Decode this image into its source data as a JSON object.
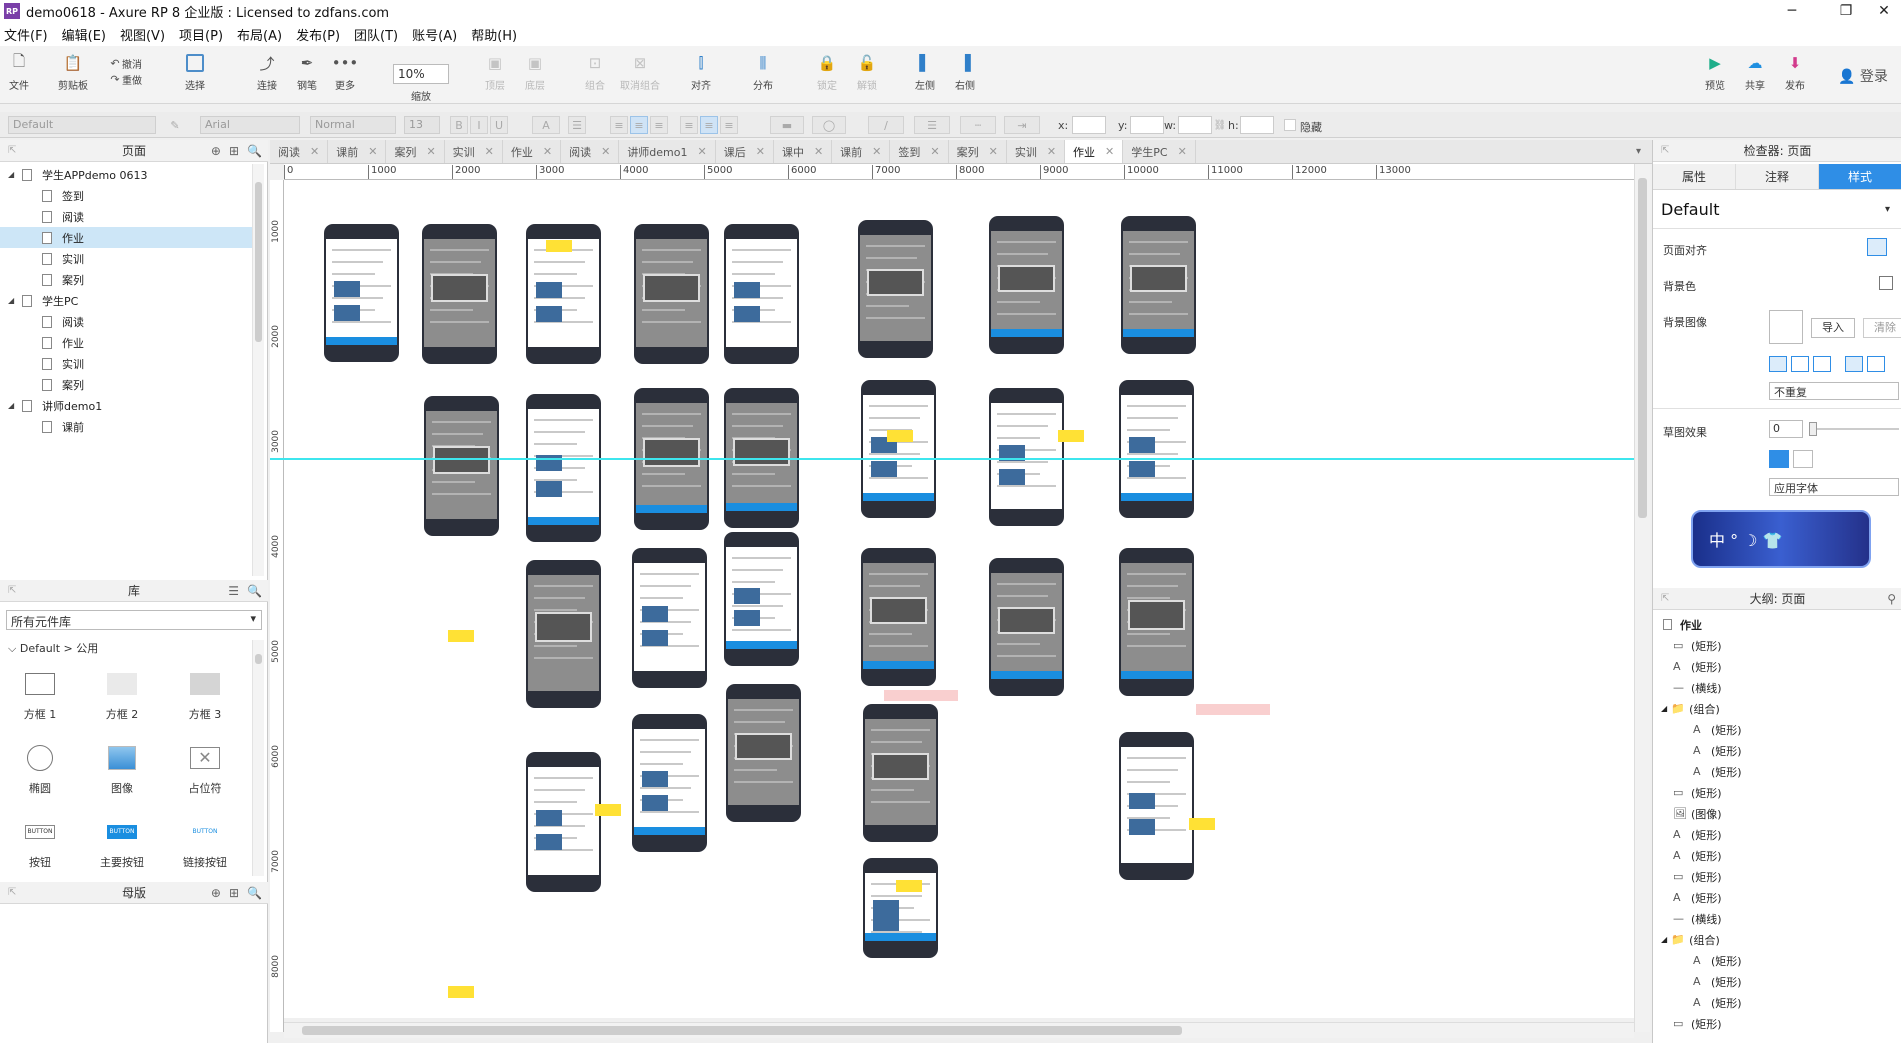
{
  "window": {
    "title": "demo0618 - Axure RP 8 企业版 : Licensed to zdfans.com",
    "app_icon": "RP"
  },
  "menu": [
    "文件(F)",
    "编辑(E)",
    "视图(V)",
    "项目(P)",
    "布局(A)",
    "发布(P)",
    "团队(T)",
    "账号(A)",
    "帮助(H)"
  ],
  "toolbar": {
    "file": "文件",
    "clipboard": "剪贴板",
    "undo": "撤消",
    "redo": "重做",
    "select": "选择",
    "connect": "连接",
    "pen": "钢笔",
    "more": "更多",
    "zoom_value": "10%",
    "zoom_label": "缩放",
    "top": "顶层",
    "bottom": "底层",
    "group": "组合",
    "ungroup": "取消组合",
    "align": "对齐",
    "distribute": "分布",
    "lock": "锁定",
    "unlock": "解锁",
    "left": "左侧",
    "right": "右侧",
    "preview": "预览",
    "share": "共享",
    "publish": "发布",
    "login": "登录"
  },
  "format": {
    "style": "Default",
    "font": "Arial",
    "weight": "Normal",
    "size": "13",
    "x_label": "x:",
    "y_label": "y:",
    "w_label": "w:",
    "h_label": "h:",
    "hide_label": "隐藏"
  },
  "pages_panel": {
    "title": "页面",
    "tree": [
      {
        "label": "学生APPdemo 0613",
        "type": "folder"
      },
      {
        "label": "签到",
        "type": "page"
      },
      {
        "label": "阅读",
        "type": "page"
      },
      {
        "label": "作业",
        "type": "page",
        "selected": true
      },
      {
        "label": "实训",
        "type": "page"
      },
      {
        "label": "案列",
        "type": "page"
      },
      {
        "label": "学生PC",
        "type": "folder"
      },
      {
        "label": "阅读",
        "type": "page"
      },
      {
        "label": "作业",
        "type": "page"
      },
      {
        "label": "实训",
        "type": "page"
      },
      {
        "label": "案列",
        "type": "page"
      },
      {
        "label": "讲师demo1",
        "type": "folder"
      },
      {
        "label": "课前",
        "type": "page"
      }
    ]
  },
  "library_panel": {
    "title": "库",
    "selector": "所有元件库",
    "group": "Default > 公用",
    "widgets": [
      {
        "label": "方框 1",
        "icon": "rect-outline"
      },
      {
        "label": "方框 2",
        "icon": "rect-light"
      },
      {
        "label": "方框 3",
        "icon": "rect-gray"
      },
      {
        "label": "椭圆",
        "icon": "ellipse"
      },
      {
        "label": "图像",
        "icon": "image"
      },
      {
        "label": "占位符",
        "icon": "placeholder"
      },
      {
        "label": "按钮",
        "icon": "button"
      },
      {
        "label": "主要按钮",
        "icon": "primary-button"
      },
      {
        "label": "链接按钮",
        "icon": "link-button"
      }
    ],
    "button_text": [
      "BUTTON",
      "BUTTON",
      "BUTTON"
    ]
  },
  "masters_panel": {
    "title": "母版"
  },
  "tabs": [
    {
      "label": "阅读"
    },
    {
      "label": "课前"
    },
    {
      "label": "案列"
    },
    {
      "label": "实训"
    },
    {
      "label": "作业"
    },
    {
      "label": "阅读"
    },
    {
      "label": "讲师demo1"
    },
    {
      "label": "课后"
    },
    {
      "label": "课中"
    },
    {
      "label": "课前"
    },
    {
      "label": "签到"
    },
    {
      "label": "案列"
    },
    {
      "label": "实训"
    },
    {
      "label": "作业",
      "active": true
    },
    {
      "label": "学生PC"
    }
  ],
  "ruler_h": [
    "0",
    "1000",
    "2000",
    "3000",
    "4000",
    "5000",
    "6000",
    "7000",
    "8000",
    "9000",
    "10000",
    "11000",
    "12000",
    "13000"
  ],
  "ruler_v": [
    "1000",
    "2000",
    "3000",
    "4000",
    "5000",
    "6000",
    "7000",
    "8000"
  ],
  "inspector": {
    "title": "检查器: 页面",
    "tabs": [
      "属性",
      "注释",
      "样式"
    ],
    "active_tab": "样式",
    "style_name": "Default",
    "page_align": "页面对齐",
    "bg_color": "背景色",
    "bg_image": "背景图像",
    "import": "导入",
    "clear": "清除",
    "repeat": "不重复",
    "sketch": "草图效果",
    "sketch_value": "0",
    "apply_font": "应用字体",
    "banner_text": "中 ° ☽ 👕"
  },
  "outline": {
    "title": "大纲: 页面",
    "root": "作业",
    "items": [
      {
        "label": "(矩形)",
        "icon": "rect",
        "depth": 1
      },
      {
        "label": "(矩形)",
        "icon": "text",
        "depth": 1
      },
      {
        "label": "(横线)",
        "icon": "line",
        "depth": 1
      },
      {
        "label": "(组合)",
        "icon": "folder",
        "depth": 1
      },
      {
        "label": "(矩形)",
        "icon": "text",
        "depth": 2
      },
      {
        "label": "(矩形)",
        "icon": "text",
        "depth": 2
      },
      {
        "label": "(矩形)",
        "icon": "text",
        "depth": 2
      },
      {
        "label": "(矩形)",
        "icon": "rect",
        "depth": 1
      },
      {
        "label": "(图像)",
        "icon": "image",
        "depth": 1
      },
      {
        "label": "(矩形)",
        "icon": "text",
        "depth": 1
      },
      {
        "label": "(矩形)",
        "icon": "text",
        "depth": 1
      },
      {
        "label": "(矩形)",
        "icon": "rect",
        "depth": 1
      },
      {
        "label": "(矩形)",
        "icon": "text",
        "depth": 1
      },
      {
        "label": "(横线)",
        "icon": "line",
        "depth": 1
      },
      {
        "label": "(组合)",
        "icon": "folder",
        "depth": 1
      },
      {
        "label": "(矩形)",
        "icon": "text",
        "depth": 2
      },
      {
        "label": "(矩形)",
        "icon": "text",
        "depth": 2
      },
      {
        "label": "(矩形)",
        "icon": "text",
        "depth": 2
      },
      {
        "label": "(矩形)",
        "icon": "rect",
        "depth": 1
      }
    ]
  },
  "colors": {
    "accent": "#2f8ee6",
    "guide": "#3ee6ee",
    "phone_frame": "#2b2f3a",
    "note": "#ffe135"
  }
}
